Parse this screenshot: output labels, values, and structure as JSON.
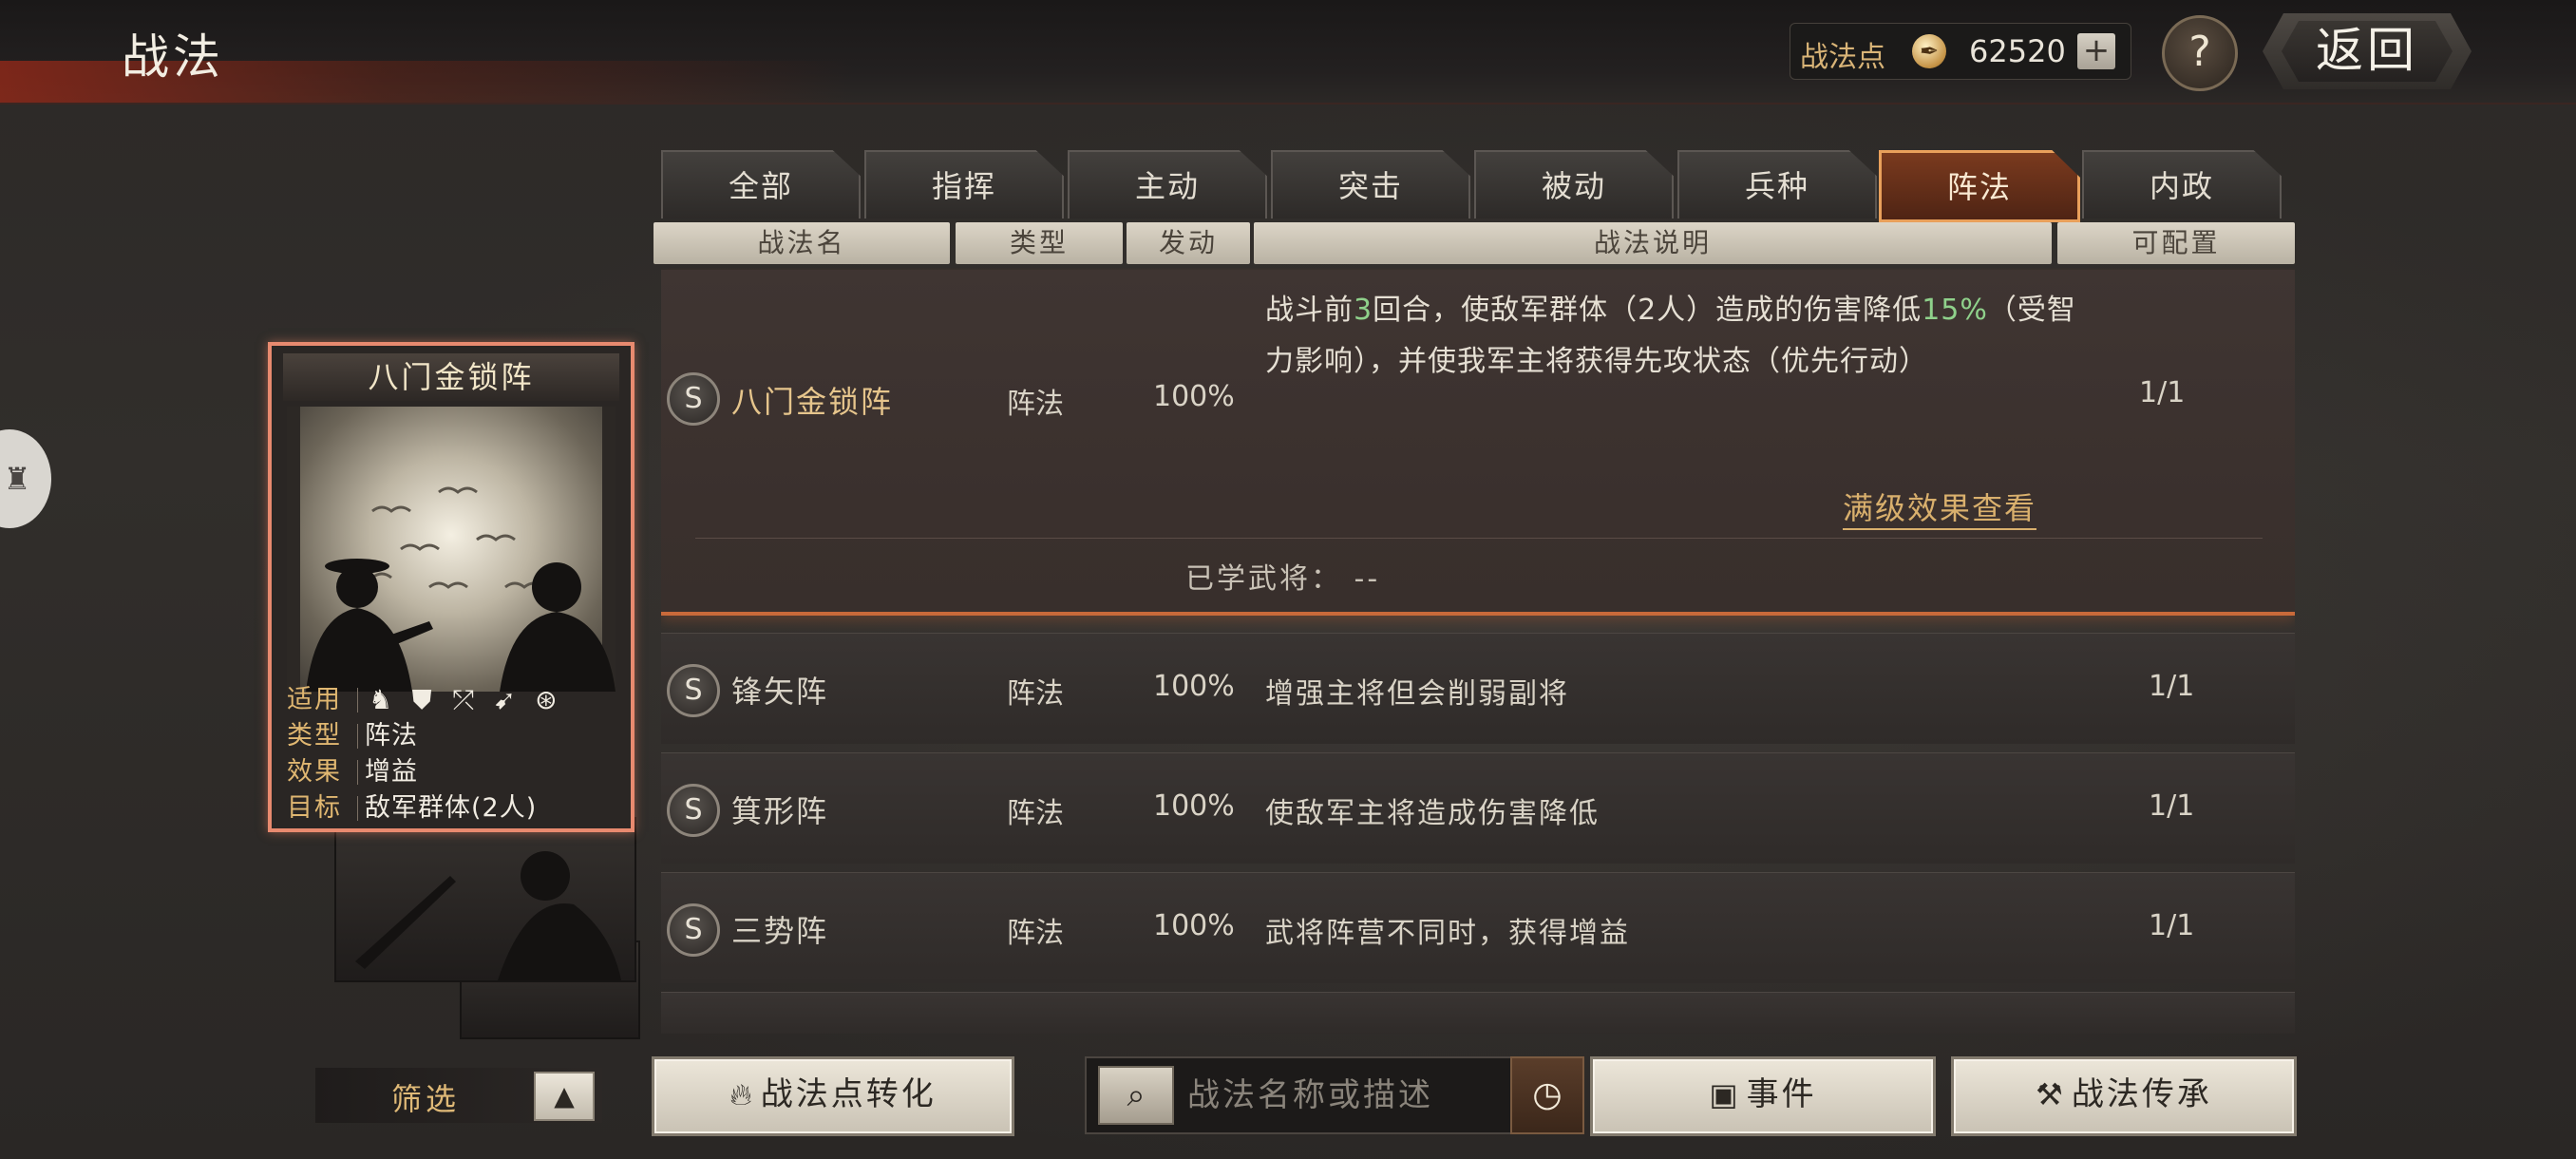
{
  "header": {
    "title": "战法",
    "points_label": "战法点",
    "points_icon": "feather-coin-icon",
    "points_value": "62520",
    "plus_label": "+",
    "help_label": "?",
    "back_label": "返回"
  },
  "tabs": [
    {
      "label": "全部",
      "active": false
    },
    {
      "label": "指挥",
      "active": false
    },
    {
      "label": "主动",
      "active": false
    },
    {
      "label": "突击",
      "active": false
    },
    {
      "label": "被动",
      "active": false
    },
    {
      "label": "兵种",
      "active": false
    },
    {
      "label": "阵法",
      "active": true
    },
    {
      "label": "内政",
      "active": false
    }
  ],
  "columns": {
    "name": "战法名",
    "type": "类型",
    "rate": "发动",
    "desc": "战法说明",
    "config": "可配置"
  },
  "rows": [
    {
      "grade": "S",
      "name": "八门金锁阵",
      "type": "阵法",
      "rate": "100%",
      "desc_parts": [
        "战斗前",
        "3",
        "回合，使敌军群体（2人）造成的伤害降低",
        "15%",
        "（受智力影响），并使我军主将获得先攻状态（优先行动）"
      ],
      "config": "1/1",
      "max_level_link": "满级效果查看",
      "learned": "已学武将： --"
    },
    {
      "grade": "S",
      "name": "锋矢阵",
      "type": "阵法",
      "rate": "100%",
      "desc": "增强主将但会削弱副将",
      "config": "1/1"
    },
    {
      "grade": "S",
      "name": "箕形阵",
      "type": "阵法",
      "rate": "100%",
      "desc": "使敌军主将造成伤害降低",
      "config": "1/1"
    },
    {
      "grade": "S",
      "name": "三势阵",
      "type": "阵法",
      "rate": "100%",
      "desc": "武将阵营不同时，获得增益",
      "config": "1/1"
    }
  ],
  "card": {
    "title": "八门金锁阵",
    "apply_label": "适用",
    "apply_icons": [
      "cavalry-icon",
      "shield-icon",
      "bow-icon",
      "spear-icon",
      "wheel-icon"
    ],
    "type_label": "类型",
    "type_value": "阵法",
    "effect_label": "效果",
    "effect_value": "增益",
    "target_label": "目标",
    "target_value": "敌军群体(2人)"
  },
  "bottom": {
    "filter_label": "筛选",
    "filter_toggle": "▲",
    "convert_label": "战法点转化",
    "search_placeholder": "战法名称或描述",
    "event_label": "事件",
    "inherit_label": "战法传承"
  },
  "colors": {
    "accent_orange": "#e9a05b",
    "highlight_green": "#8fd18b",
    "gold_text": "#d9b06d"
  }
}
